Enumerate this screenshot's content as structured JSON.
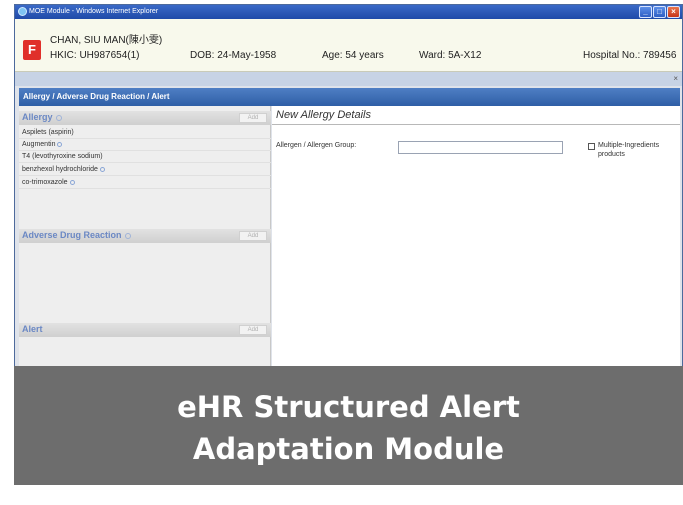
{
  "window": {
    "title": "MOE Module - Windows Internet Explorer"
  },
  "patient": {
    "gender_badge": "F",
    "name": "CHAN, SIU MAN(陳小雯)",
    "hkic": "HKIC: UH987654(1)",
    "dob": "DOB: 24-May-1958",
    "age": "Age: 54 years",
    "ward": "Ward: 5A-X12",
    "hospital_no": "Hospital No.: 789456"
  },
  "section_header": "Allergy / Adverse Drug Reaction / Alert",
  "left": {
    "add_label": "Add",
    "allergy": {
      "title": "Allergy",
      "items": [
        {
          "label": "Aspilets (aspirin)"
        },
        {
          "label": "Augmentin"
        },
        {
          "label": "T4 (levothyroxine sodium)"
        },
        {
          "label": "benzhexol hydrochloride"
        },
        {
          "label": "co-trimoxazole"
        }
      ]
    },
    "adr": {
      "title": "Adverse Drug Reaction"
    },
    "alert": {
      "title": "Alert"
    }
  },
  "right": {
    "title": "New Allergy Details",
    "allergen_label": "Allergen / Allergen Group:",
    "allergen_value": "",
    "multi_label": "Multiple-Ingredients products"
  },
  "caption": {
    "line1": "eHR Structured Alert",
    "line2": "Adaptation Module"
  },
  "colors": {
    "accent": "#2e5ea6",
    "badge": "#e0302a",
    "banner": "#6d6d6d"
  }
}
